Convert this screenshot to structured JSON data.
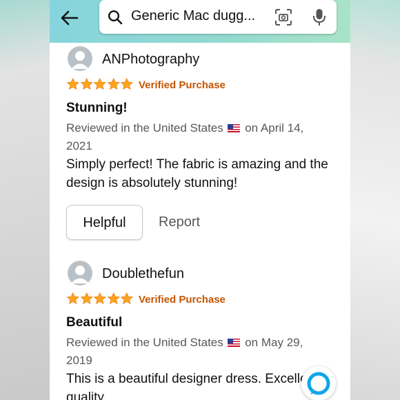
{
  "search": {
    "query": "Generic Mac dugg..."
  },
  "icons": {
    "back": "back-arrow-icon",
    "search": "search-icon",
    "camera": "camera-scan-icon",
    "mic": "microphone-icon",
    "alexa": "alexa-icon"
  },
  "colors": {
    "header_start": "#86d4dd",
    "header_end": "#a9e3c8",
    "star": "#ffa41c",
    "verified": "#c45500",
    "alexa": "#0ea5e9"
  },
  "reviews": [
    {
      "author": "ANPhotography",
      "rating": 5,
      "verified_label": "Verified Purchase",
      "title": "Stunning!",
      "meta_prefix": "Reviewed in the United States",
      "meta_suffix": "on April 14, 2021",
      "body": "Simply perfect! The fabric is amazing and the design is absolutely stunning!",
      "helpful_label": "Helpful",
      "report_label": "Report"
    },
    {
      "author": "Doublethefun",
      "rating": 5,
      "verified_label": "Verified Purchase",
      "title": "Beautiful",
      "meta_prefix": "Reviewed in the United States",
      "meta_suffix": "on May 29, 2019",
      "body": "This is a beautiful designer dress. Excellent quality."
    }
  ]
}
